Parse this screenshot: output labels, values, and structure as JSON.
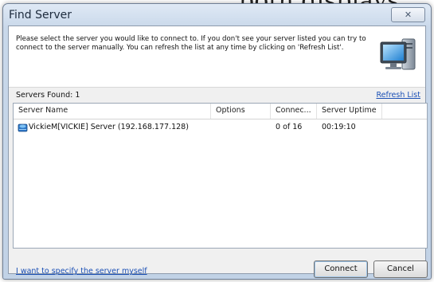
{
  "background_text": "both displays.",
  "window": {
    "title": "Find Server",
    "close_glyph": "✕"
  },
  "intro_text": "Please select the server you would like to connect to. If you don't see your server listed you can try to connect to the server manually. You can refresh the list at any time by clicking on 'Refresh List'.",
  "servers_found_label": "Servers Found: 1",
  "refresh_link": "Refresh List",
  "table": {
    "headers": [
      "Server Name",
      "Options",
      "Connec...",
      "Server Uptime"
    ],
    "rows": [
      {
        "name": "VickieM[VICKIE] Server (192.168.177.128)",
        "options": "",
        "connections": "0 of 16",
        "uptime": "00:19:10"
      }
    ]
  },
  "specify_link": "I want to specify the server myself",
  "buttons": {
    "connect": "Connect",
    "cancel": "Cancel"
  },
  "icons": {
    "monitor": "computer-monitor-icon",
    "server": "server-globe-icon"
  }
}
